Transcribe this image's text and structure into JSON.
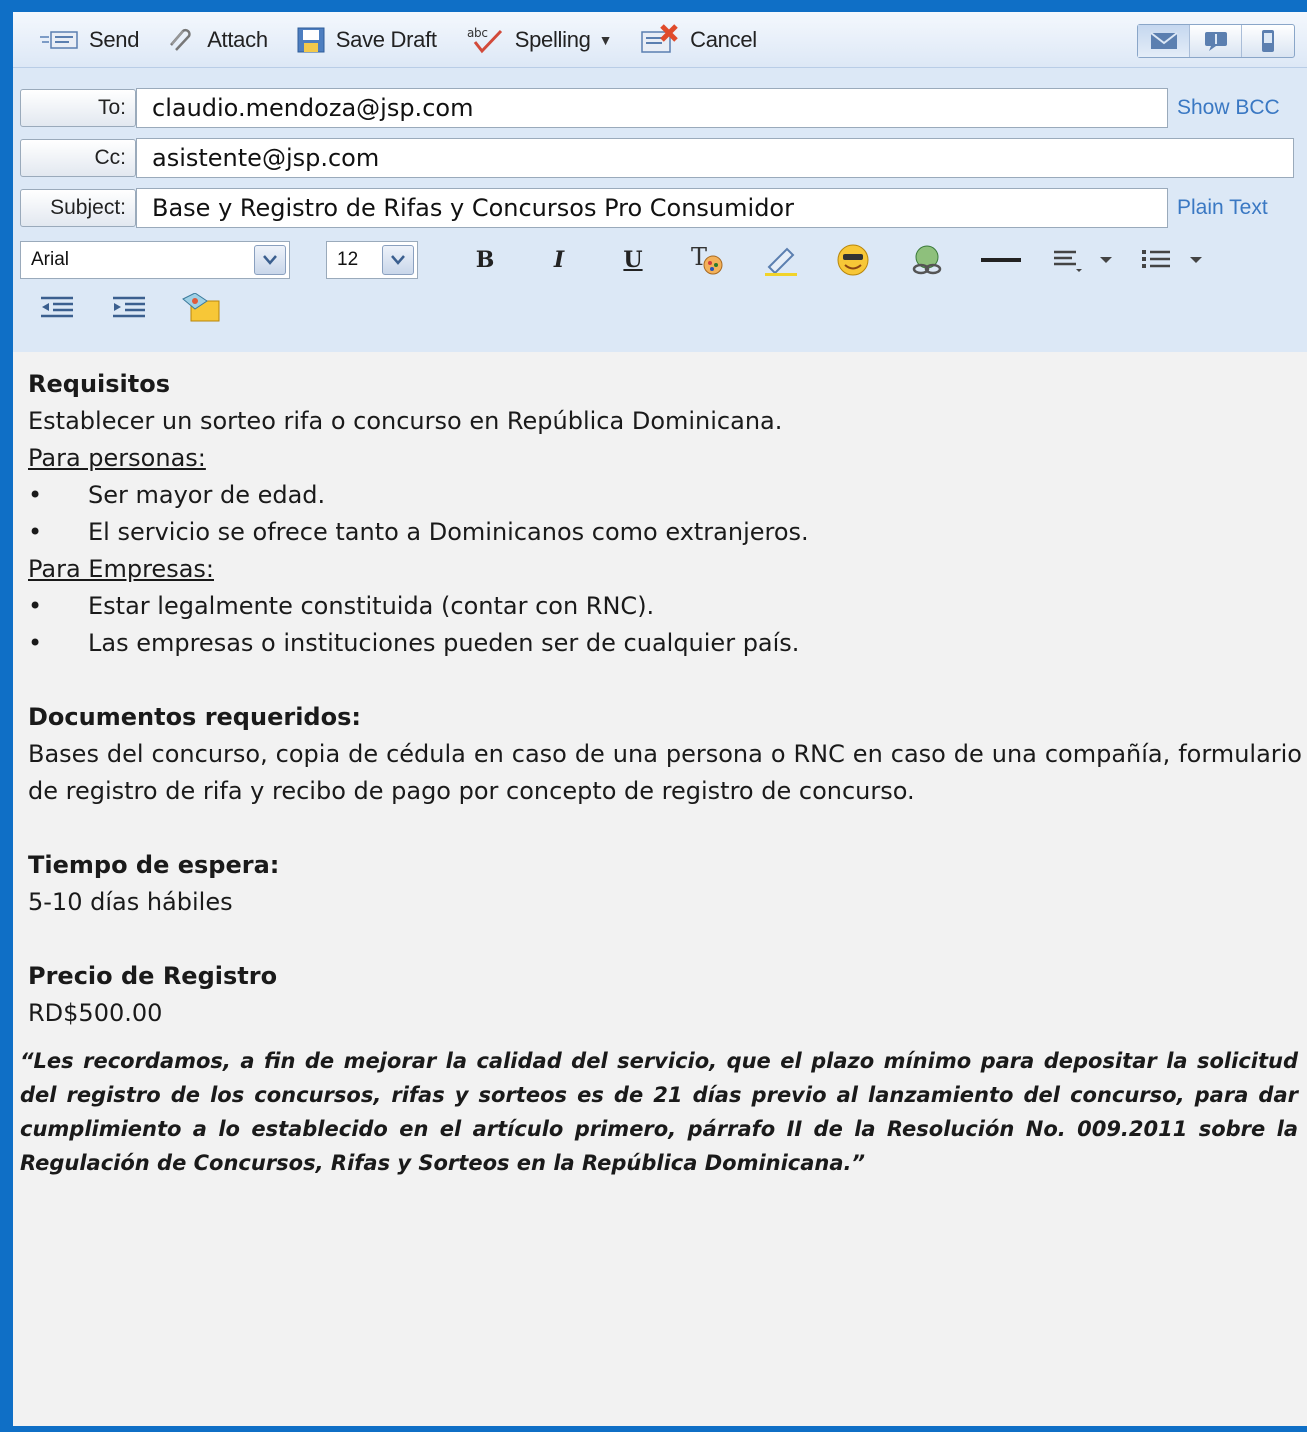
{
  "toolbar": {
    "send_label": "Send",
    "attach_label": "Attach",
    "save_draft_label": "Save Draft",
    "spelling_label": "Spelling",
    "cancel_label": "Cancel"
  },
  "header": {
    "to_label": "To:",
    "to_value": "claudio.mendoza@jsp.com",
    "show_bcc": "Show BCC",
    "cc_label": "Cc:",
    "cc_value": "asistente@jsp.com",
    "subject_label": "Subject:",
    "subject_value": "Base y Registro de Rifas y Concursos Pro Consumidor",
    "plain_text": "Plain Text"
  },
  "format": {
    "font_family": "Arial",
    "font_size": "12",
    "bold": "B",
    "italic": "I",
    "underline": "U"
  },
  "body": {
    "req_heading": "Requisitos",
    "req_text": "Establecer un sorteo rifa o concurso en República Dominicana.",
    "personas_label": "Para personas:",
    "personas_items": [
      "Ser mayor de edad.",
      "El servicio se ofrece tanto a Dominicanos como extranjeros."
    ],
    "empresas_label": "Para Empresas:",
    "empresas_items": [
      "Estar legalmente constituida (contar con RNC).",
      "Las empresas o instituciones pueden ser de cualquier país."
    ],
    "docs_heading": "Documentos requeridos:",
    "docs_text": "Bases del concurso, copia de cédula en caso de una persona o RNC en caso de una compañía, formulario de registro de rifa y recibo de pago por concepto de registro de concurso.",
    "tiempo_heading": "Tiempo de espera:",
    "tiempo_text": "5-10 días hábiles",
    "precio_heading": "Precio de Registro",
    "precio_text": "RD$500.00",
    "note": "“Les recordamos, a fin de mejorar la calidad del servicio, que el plazo mínimo para depositar la solicitud del registro de los concursos, rifas y sorteos es de 21 días previo al lanzamiento del concurso, para dar cumplimiento a lo establecido en el artículo primero, párrafo II de la Resolución No. 009.2011 sobre la Regulación de Concursos, Rifas y Sorteos en la República Dominicana.”"
  }
}
